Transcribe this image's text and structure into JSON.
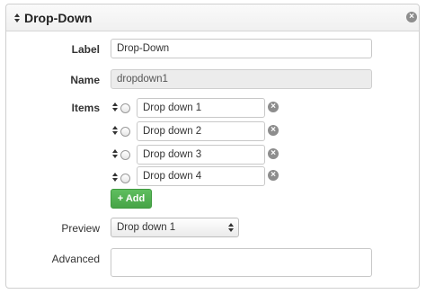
{
  "panel": {
    "title": "Drop-Down",
    "drag_icon": "sort-arrows-icon",
    "close_icon": "close-circle-icon"
  },
  "form": {
    "label": {
      "label": "Label",
      "value": "Drop-Down"
    },
    "name": {
      "label": "Name",
      "value": "dropdown1"
    },
    "items": {
      "label": "Items",
      "entries": [
        {
          "value": "Drop down 1"
        },
        {
          "value": "Drop down 2"
        },
        {
          "value": "Drop down 3"
        },
        {
          "value": "Drop down 4"
        }
      ],
      "add_label": "Add",
      "add_icon": "plus-icon",
      "remove_icon": "remove-circle-icon"
    },
    "preview": {
      "label": "Preview",
      "selected": "Drop down 1"
    },
    "advanced": {
      "label": "Advanced",
      "value": ""
    }
  },
  "colors": {
    "add_button": "#47a447",
    "header_bg": "#f0f0f0",
    "border": "#cfcfcf"
  }
}
